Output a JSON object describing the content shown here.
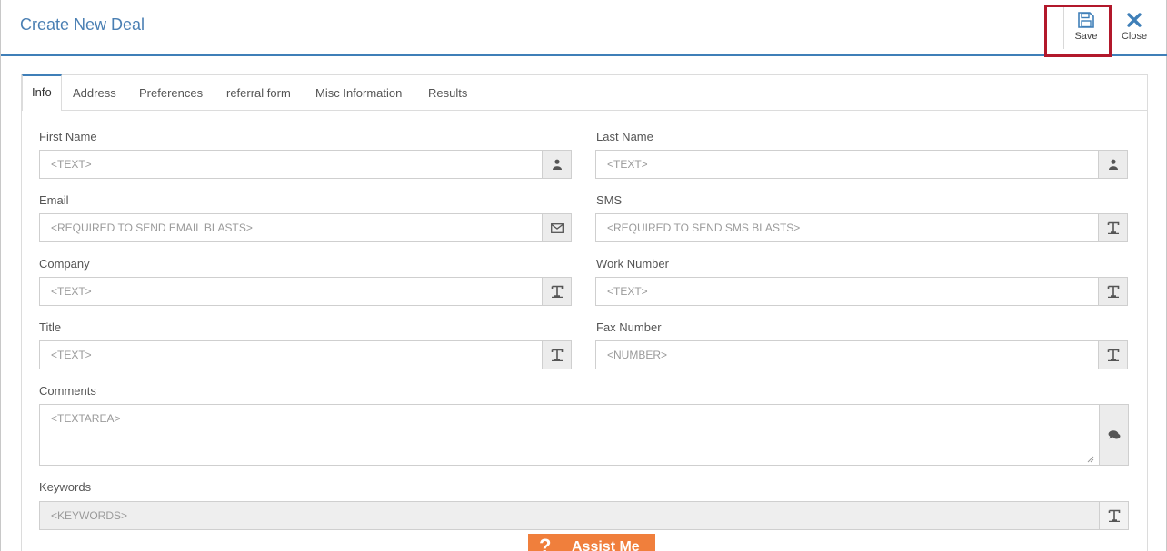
{
  "header": {
    "title": "Create New Deal"
  },
  "toolbar": {
    "save_label": "Save",
    "close_label": "Close"
  },
  "tabs": [
    "Info",
    "Address",
    "Preferences",
    "referral form",
    "Misc Information",
    "Results"
  ],
  "form": {
    "first_name": {
      "label": "First Name",
      "placeholder": "<TEXT>",
      "icon": "person-icon"
    },
    "last_name": {
      "label": "Last Name",
      "placeholder": "<TEXT>",
      "icon": "person-icon"
    },
    "email": {
      "label": "Email",
      "placeholder": "<REQUIRED TO SEND EMAIL BLASTS>",
      "icon": "envelope-icon"
    },
    "sms": {
      "label": "SMS",
      "placeholder": "<REQUIRED TO SEND SMS BLASTS>",
      "icon": "text-icon"
    },
    "company": {
      "label": "Company",
      "placeholder": "<TEXT>",
      "icon": "text-icon"
    },
    "work_number": {
      "label": "Work Number",
      "placeholder": "<TEXT>",
      "icon": "text-icon"
    },
    "title": {
      "label": "Title",
      "placeholder": "<TEXT>",
      "icon": "text-icon"
    },
    "fax_number": {
      "label": "Fax Number",
      "placeholder": "<NUMBER>",
      "icon": "text-icon"
    },
    "comments": {
      "label": "Comments",
      "placeholder": "<TEXTAREA>",
      "icon": "comments-icon"
    },
    "keywords": {
      "label": "Keywords",
      "placeholder": "<KEYWORDS>",
      "icon": "text-icon"
    }
  },
  "assist": {
    "q": "?",
    "label": "Assist Me"
  },
  "colors": {
    "accent": "#3f7fb8",
    "highlight": "#b2182b",
    "assist": "#f07f3c"
  }
}
